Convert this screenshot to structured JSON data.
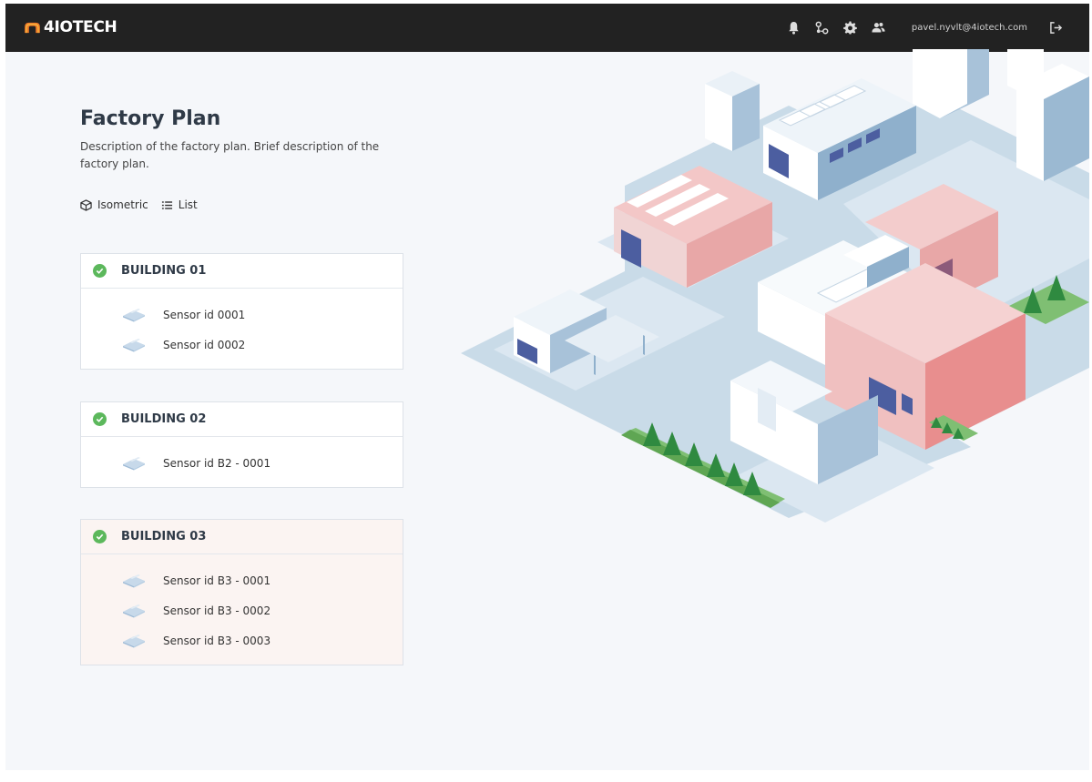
{
  "header": {
    "logo_text": "4IOTECH",
    "user_email": "pavel.nyvlt@4iotech.com",
    "icons": [
      "bell-icon",
      "network-icon",
      "gear-icon",
      "users-icon",
      "logout-icon"
    ]
  },
  "page": {
    "title": "Factory Plan",
    "description": "Description of the factory plan. Brief description of the factory plan."
  },
  "view_switch": {
    "isometric_label": "Isometric",
    "list_label": "List"
  },
  "buildings": [
    {
      "name": "BUILDING 01",
      "sensors": [
        "Sensor id 0001",
        "Sensor id 0002"
      ]
    },
    {
      "name": "BUILDING 02",
      "sensors": [
        "Sensor id B2 - 0001"
      ]
    },
    {
      "name": "BUILDING 03",
      "sensors": [
        "Sensor id B3 - 0001",
        "Sensor id B3 - 0002",
        "Sensor id B3 - 0003"
      ]
    }
  ],
  "colors": {
    "topbar": "#222222",
    "status_ok": "#5cb85c",
    "highlight_bg": "#fbf4f2",
    "building_red": "#e8a7a7",
    "building_blue": "#8fb0cc"
  }
}
